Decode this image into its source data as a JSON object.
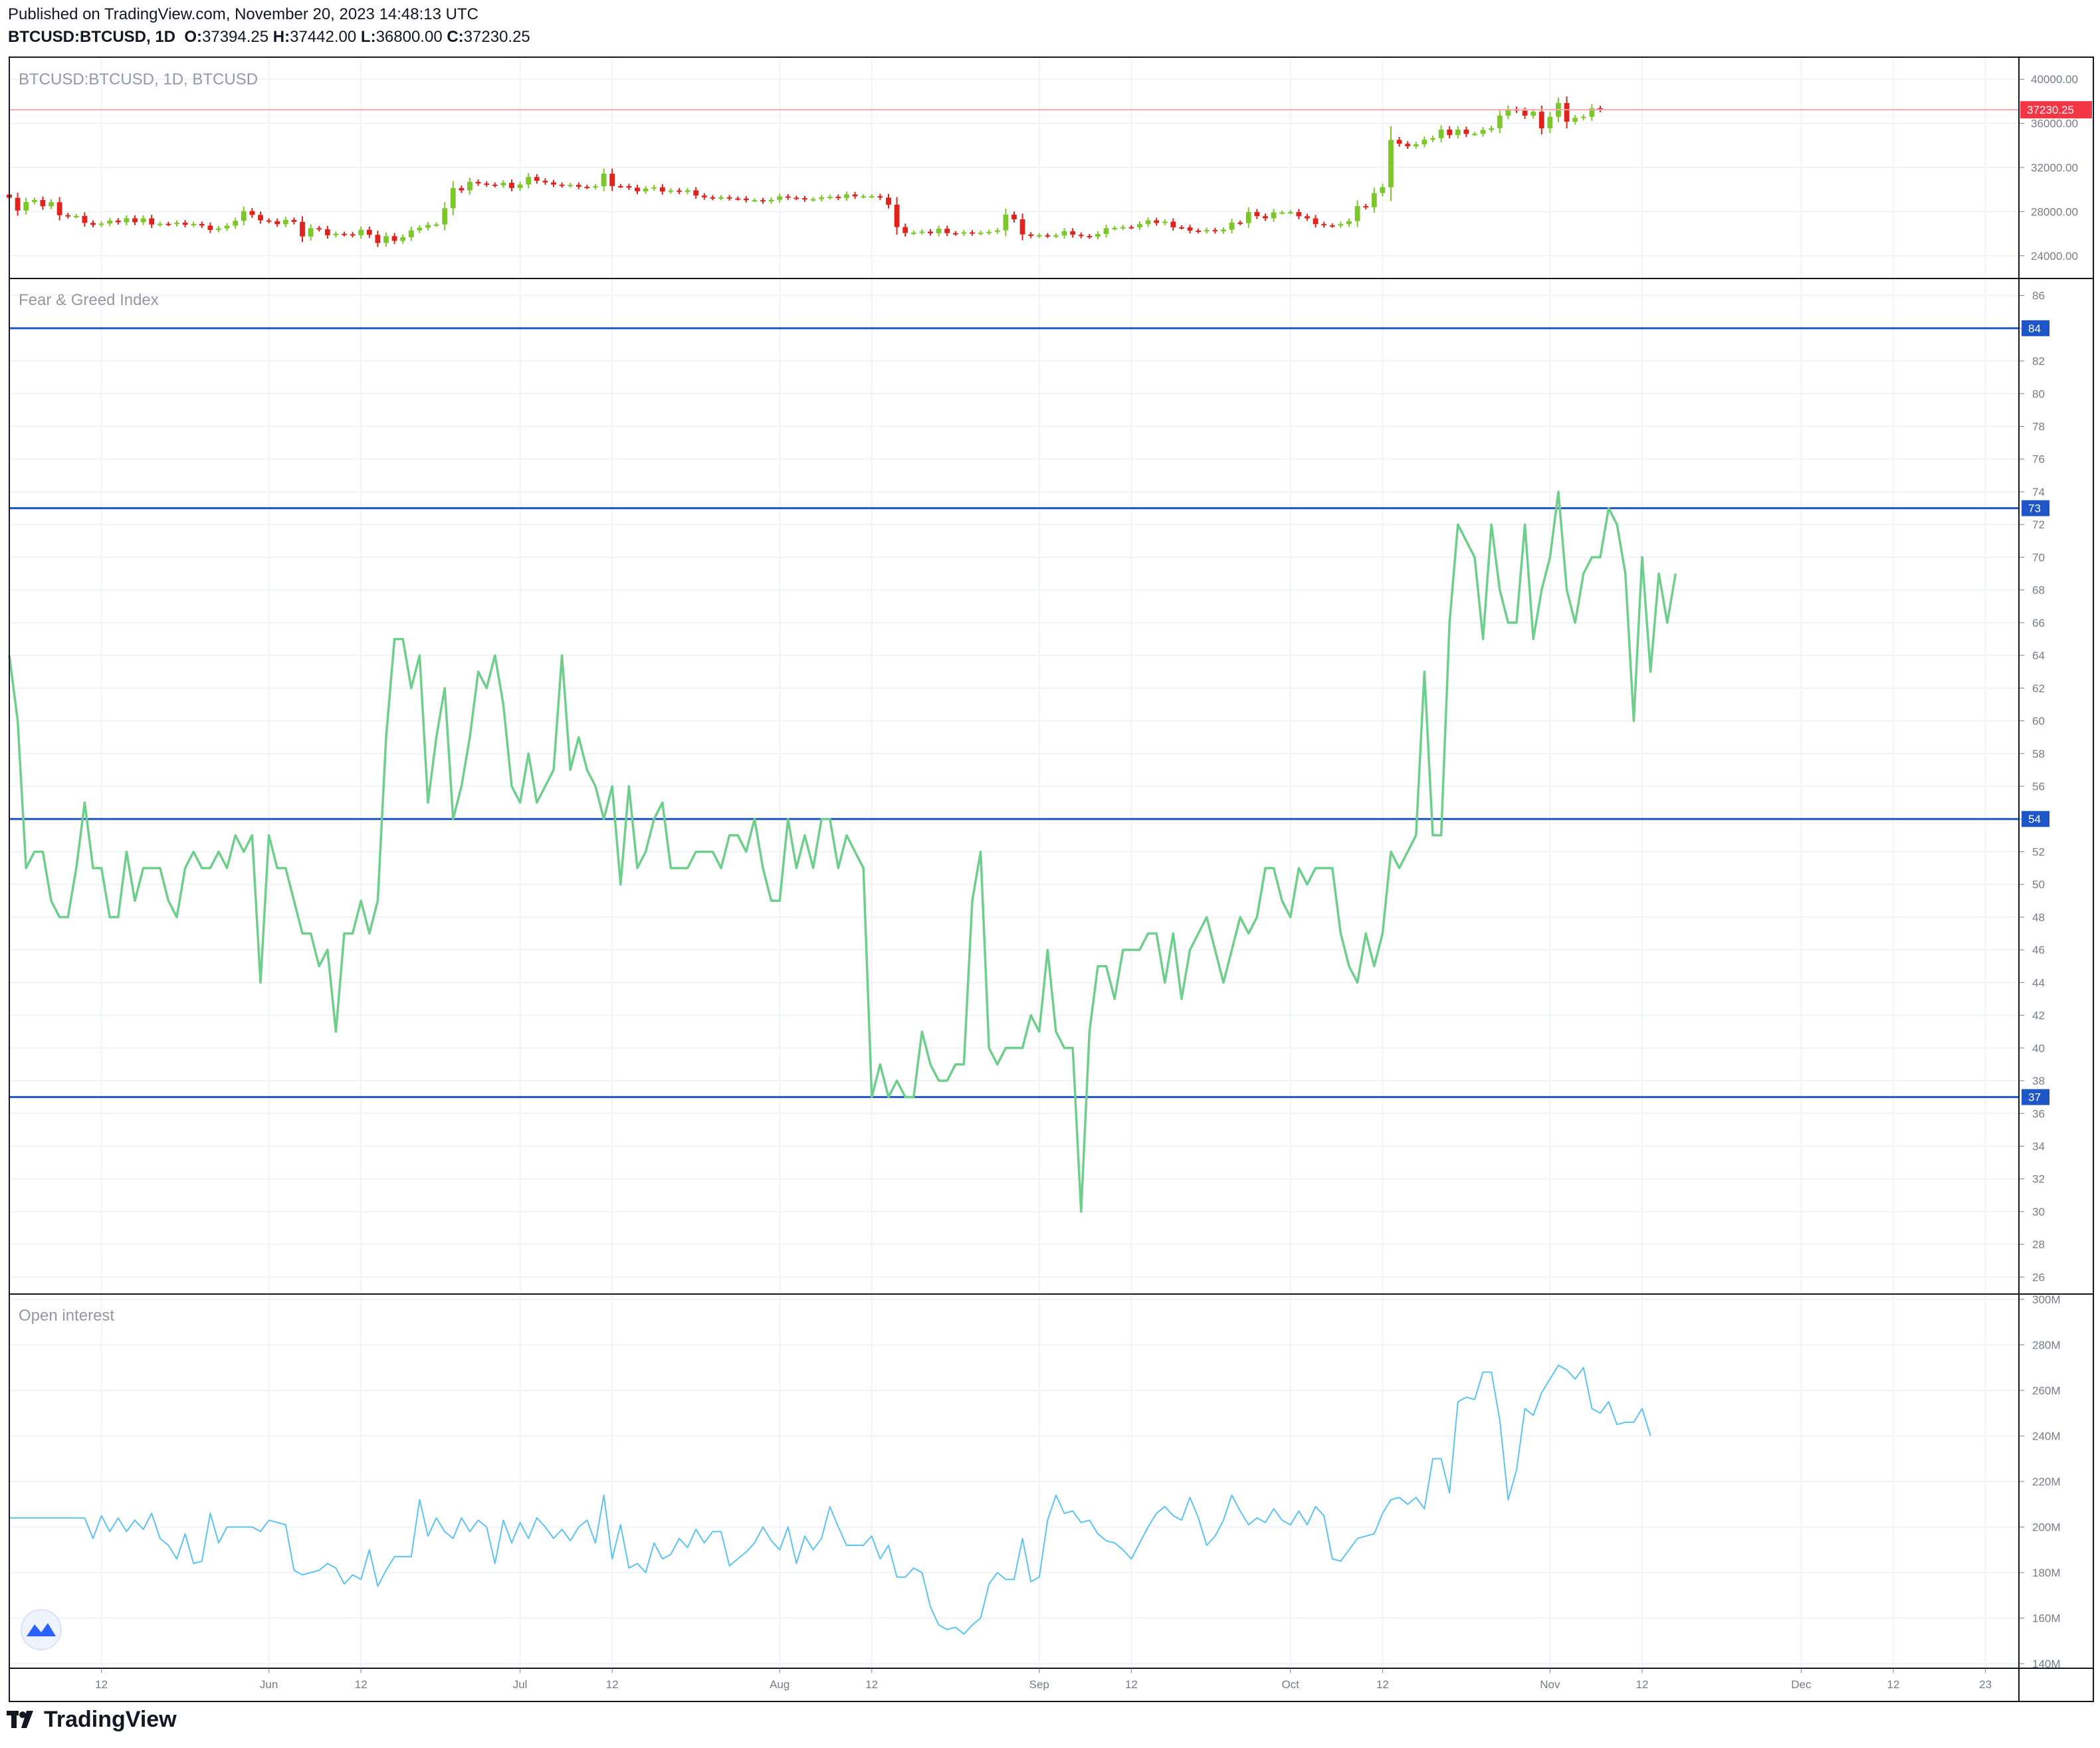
{
  "header": {
    "published": "Published on TradingView.com, November 20, 2023 14:48:13 UTC",
    "symbol": "BTCUSD:BTCUSD, 1D",
    "o_label": "O:",
    "o_value": "37394.25",
    "h_label": "H:",
    "h_value": "37442.00",
    "l_label": "L:",
    "l_value": "36800.00",
    "c_label": "C:",
    "c_value": "37230.25"
  },
  "brand": {
    "name": "TradingView",
    "logo": "tradingview-logo-icon"
  },
  "colors": {
    "up": "#7cc72a",
    "down": "#e0231c",
    "fg_line": "#6ecf8c",
    "oi_line": "#5cc4f2",
    "hline": "#1f56c7",
    "price_label": "#f23645",
    "grid": "#f0f3fa"
  },
  "chart_data": [
    {
      "type": "candlestick",
      "title": "BTCUSD:BTCUSD, 1D, BTCUSD",
      "ylim": [
        22000,
        42000
      ],
      "yticks": [
        "24000.00",
        "28000.00",
        "32000.00",
        "36000.00",
        "40000.00"
      ],
      "last_price": "37230.25",
      "start_date": "2023-05-01",
      "end_date": "2023-11-20",
      "closes": [
        29250,
        28100,
        28870,
        29050,
        28490,
        28850,
        27680,
        27580,
        27610,
        26980,
        26800,
        26920,
        27190,
        27030,
        27400,
        27040,
        27390,
        26830,
        26900,
        26870,
        27000,
        26800,
        26880,
        26730,
        26340,
        26480,
        26720,
        27160,
        28050,
        27700,
        27210,
        27130,
        26860,
        27250,
        27070,
        25750,
        26500,
        26400,
        25860,
        25990,
        25950,
        25860,
        26350,
        25900,
        25160,
        25780,
        25350,
        25680,
        26300,
        26540,
        26800,
        26840,
        28310,
        30130,
        29920,
        30700,
        30550,
        30450,
        30380,
        30610,
        30140,
        30460,
        31140,
        30800,
        30650,
        30450,
        30360,
        30420,
        30250,
        30220,
        30300,
        31440,
        30320,
        30310,
        30170,
        29840,
        30090,
        30210,
        29820,
        29920,
        29790,
        29930,
        29460,
        29300,
        29230,
        29300,
        29200,
        29190,
        29040,
        29040,
        28920,
        29070,
        29380,
        29260,
        29220,
        29100,
        29130,
        29290,
        29350,
        29240,
        29560,
        29380,
        29400,
        29400,
        29270,
        28630,
        26600,
        26060,
        26100,
        26190,
        26040,
        26450,
        26050,
        26000,
        26120,
        26020,
        26090,
        26170,
        26310,
        27730,
        27300,
        25930,
        25800,
        25860,
        25790,
        25840,
        26230,
        25900,
        25790,
        25720,
        25970,
        26500,
        26520,
        26600,
        26580,
        26870,
        27210,
        26970,
        27090,
        26580,
        26570,
        26280,
        26220,
        26330,
        26210,
        26360,
        27010,
        26960,
        27960,
        27590,
        27390,
        27930,
        27930,
        27960,
        27580,
        27390,
        26870,
        26750,
        26730,
        26870,
        27140,
        28500,
        28400,
        29680,
        30210,
        34500,
        34150,
        33920,
        34100,
        34520,
        34660,
        35440,
        34940,
        35430,
        35040,
        35050,
        35400,
        35560,
        36700,
        37300,
        37150,
        36700,
        37050,
        35550,
        36600,
        37840,
        36150,
        36500,
        36600,
        37370,
        37230
      ],
      "fear_greed": {
        "title": "Fear & Greed Index",
        "ylim": [
          25,
          87
        ],
        "yticks": [
          26,
          28,
          30,
          32,
          34,
          36,
          38,
          40,
          42,
          44,
          46,
          48,
          50,
          52,
          54,
          56,
          58,
          60,
          62,
          64,
          66,
          68,
          70,
          72,
          74,
          76,
          78,
          80,
          82,
          84,
          86
        ],
        "hlines": [
          84,
          73,
          54,
          37
        ],
        "values": [
          64,
          60,
          51,
          52,
          52,
          49,
          48,
          48,
          51,
          55,
          51,
          51,
          48,
          48,
          52,
          49,
          51,
          51,
          51,
          49,
          48,
          51,
          52,
          51,
          51,
          52,
          51,
          53,
          52,
          53,
          44,
          53,
          51,
          51,
          49,
          47,
          47,
          45,
          46,
          41,
          47,
          47,
          49,
          47,
          49,
          59,
          65,
          65,
          62,
          64,
          55,
          59,
          62,
          54,
          56,
          59,
          63,
          62,
          64,
          61,
          56,
          55,
          58,
          55,
          56,
          57,
          64,
          57,
          59,
          57,
          56,
          54,
          56,
          50,
          56,
          51,
          52,
          54,
          55,
          51,
          51,
          51,
          52,
          52,
          52,
          51,
          53,
          53,
          52,
          54,
          51,
          49,
          49,
          54,
          51,
          53,
          51,
          54,
          54,
          51,
          53,
          52,
          51,
          37,
          39,
          37,
          38,
          37,
          37,
          41,
          39,
          38,
          38,
          39,
          39,
          49,
          52,
          40,
          39,
          40,
          40,
          40,
          42,
          41,
          46,
          41,
          40,
          40,
          30,
          41,
          45,
          45,
          43,
          46,
          46,
          46,
          47,
          47,
          44,
          47,
          43,
          46,
          47,
          48,
          46,
          44,
          46,
          48,
          47,
          48,
          51,
          51,
          49,
          48,
          51,
          50,
          51,
          51,
          51,
          47,
          45,
          44,
          47,
          45,
          47,
          52,
          51,
          52,
          53,
          63,
          53,
          53,
          66,
          72,
          71,
          70,
          65,
          72,
          68,
          66,
          66,
          72,
          65,
          68,
          70,
          74,
          68,
          66,
          69,
          70,
          70,
          73,
          72,
          69,
          60,
          70,
          63,
          69,
          66,
          69
        ]
      },
      "open_interest": {
        "title": "Open interest",
        "ylim": [
          138,
          302
        ],
        "yticks": [
          "140M",
          "160M",
          "180M",
          "200M",
          "220M",
          "240M",
          "260M",
          "280M",
          "300M"
        ],
        "values": [
          204,
          204,
          204,
          204,
          204,
          204,
          204,
          204,
          204,
          204,
          195,
          205,
          198,
          204,
          198,
          203,
          199,
          206,
          195,
          192,
          186,
          197,
          184,
          185,
          206,
          193,
          200,
          200,
          200,
          200,
          198,
          203,
          202,
          201,
          181,
          179,
          180,
          181,
          184,
          182,
          175,
          179,
          177,
          190,
          174,
          181,
          187,
          187,
          187,
          212,
          196,
          204,
          198,
          195,
          204,
          198,
          203,
          200,
          184,
          203,
          193,
          202,
          195,
          204,
          200,
          195,
          199,
          194,
          200,
          203,
          193,
          214,
          186,
          201,
          182,
          184,
          180,
          193,
          186,
          188,
          195,
          191,
          199,
          193,
          198,
          198,
          183,
          186,
          189,
          193,
          200,
          194,
          190,
          200,
          184,
          196,
          190,
          195,
          209,
          200,
          192,
          192,
          192,
          196,
          186,
          192,
          178,
          178,
          182,
          180,
          165,
          157,
          155,
          156,
          153,
          157,
          160,
          175,
          180,
          177,
          177,
          195,
          176,
          178,
          203,
          214,
          206,
          207,
          202,
          203,
          197,
          194,
          193,
          190,
          186,
          193,
          200,
          206,
          209,
          205,
          203,
          213,
          204,
          192,
          196,
          203,
          214,
          207,
          201,
          204,
          202,
          208,
          203,
          201,
          207,
          201,
          209,
          205,
          186,
          185,
          190,
          195,
          196,
          197,
          206,
          212,
          213,
          210,
          213,
          208,
          230,
          230,
          215,
          255,
          257,
          256,
          268,
          268,
          247,
          212,
          225,
          252,
          249,
          259,
          265,
          271,
          269,
          265,
          270,
          252,
          250,
          255,
          245,
          246,
          246,
          252,
          240
        ]
      },
      "xaxis": {
        "tick_labels": [
          "12",
          "Jun",
          "12",
          "Jul",
          "12",
          "Aug",
          "12",
          "Sep",
          "12",
          "Oct",
          "12",
          "Nov",
          "12",
          "Dec",
          "12",
          "23"
        ],
        "tick_dates": [
          "2023-05-12",
          "2023-06-01",
          "2023-06-12",
          "2023-07-01",
          "2023-07-12",
          "2023-08-01",
          "2023-08-12",
          "2023-09-01",
          "2023-09-12",
          "2023-10-01",
          "2023-10-12",
          "2023-11-01",
          "2023-11-12",
          "2023-12-01",
          "2023-12-12",
          "2023-12-23"
        ],
        "range": [
          "2023-05-01",
          "2023-12-27"
        ]
      }
    }
  ]
}
